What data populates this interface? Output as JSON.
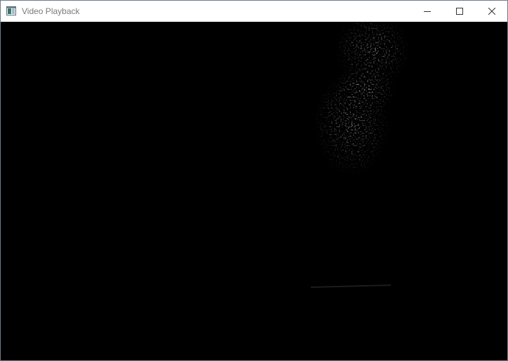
{
  "window": {
    "title": "Video Playback"
  },
  "title_buttons": {
    "minimize_icon": "minimize-icon",
    "maximize_icon": "maximize-icon",
    "close_icon": "close-icon"
  },
  "video": {
    "background_color": "#000000"
  }
}
